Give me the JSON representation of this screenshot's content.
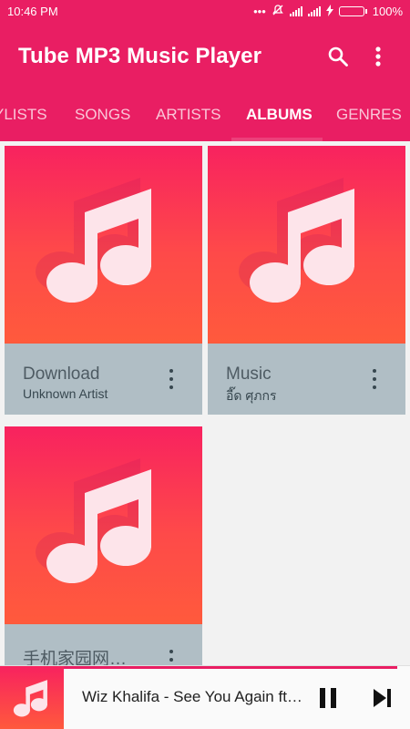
{
  "status_bar": {
    "time": "10:46  PM",
    "icons": [
      "dots-icon",
      "mute-icon",
      "signal-icon",
      "signal-icon",
      "charging-icon",
      "battery-icon"
    ],
    "battery_percent": "100%",
    "battery_level": 1.0
  },
  "app_bar": {
    "title": "Tube MP3 Music Player",
    "actions": [
      "search-icon",
      "more-vert-icon"
    ]
  },
  "tabs": [
    {
      "label": "YLISTS",
      "active": false
    },
    {
      "label": "SONGS",
      "active": false
    },
    {
      "label": "ARTISTS",
      "active": false
    },
    {
      "label": "ALBUMS",
      "active": true
    },
    {
      "label": "GENRES",
      "active": false
    }
  ],
  "albums": [
    {
      "name": "Download",
      "artist": "Unknown Artist"
    },
    {
      "name": "Music",
      "artist": "อี๊ด ศุภกร"
    },
    {
      "name": "手机家园网…",
      "artist": ""
    }
  ],
  "player": {
    "song": "Wiz Khalifa - See You Again ft. Charlie Puth",
    "controls": [
      "pause-icon",
      "skip-next-icon"
    ]
  },
  "colors": {
    "primary": "#e91e63",
    "art_gradient_top": "#f8225f",
    "art_gradient_bottom": "#ff5a3c",
    "card_footer": "#b0bec5"
  }
}
